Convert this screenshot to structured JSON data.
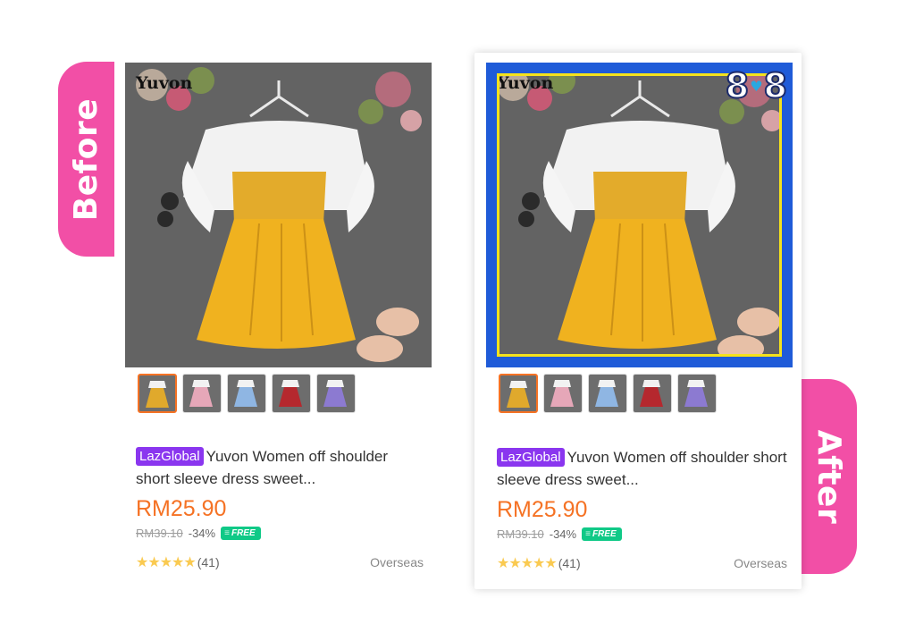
{
  "labels": {
    "before": "Before",
    "after": "After"
  },
  "badge": {
    "left": "8",
    "heart": "♥",
    "right": "8"
  },
  "colors": {
    "accent_pink": "#f24fa6",
    "price_orange": "#f57224",
    "laz_purple": "#8a36ef",
    "free_green": "#10c987",
    "frame_blue": "#1f5bd8",
    "frame_yellow": "#f5e21b"
  },
  "product": {
    "image_brand_text": "Yuvon",
    "laz_badge": "LazGlobal",
    "title": "Yuvon Women off shoulder short sleeve dress sweet...",
    "price": "RM25.90",
    "original_price": "RM39.10",
    "discount": "-34%",
    "free_tag": "FREE",
    "rating": 5,
    "stars": "★★★★★",
    "review_count": "(41)",
    "location": "Overseas",
    "thumbnails": [
      {
        "color": "#e0a92c",
        "selected": true
      },
      {
        "color": "#e6a7b8",
        "selected": false
      },
      {
        "color": "#8fb6e3",
        "selected": false
      },
      {
        "color": "#b5282e",
        "selected": false
      },
      {
        "color": "#8c7ad1",
        "selected": false
      }
    ]
  }
}
